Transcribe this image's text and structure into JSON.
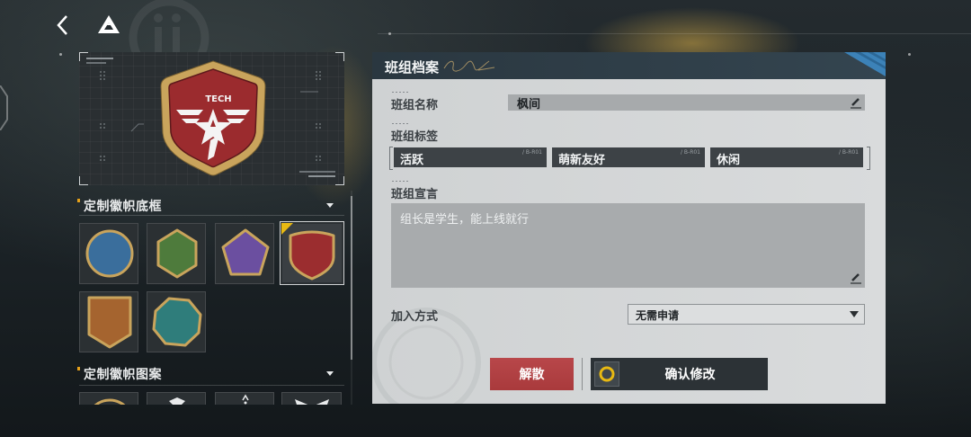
{
  "top_bar": {
    "back_icon": "chevron-left-icon",
    "logo_icon": "triangle-logo-icon"
  },
  "emblem_preview": {
    "emblem_text": "TECH",
    "border_color": "#c9a45c",
    "field_color": "#9b2b2e"
  },
  "frame_section": {
    "title": "定制徽帜底框",
    "toggle_icon": "caret-down-icon",
    "selected_index": 3,
    "options": [
      {
        "icon": "circle-frame-icon",
        "color": "#3a6e9c"
      },
      {
        "icon": "hexagon-frame-icon",
        "color": "#4e7b3c"
      },
      {
        "icon": "pentagon-frame-icon",
        "color": "#6b4fa0"
      },
      {
        "icon": "shield-frame-icon",
        "color": "#9b2d2f"
      },
      {
        "icon": "banner-frame-icon",
        "color": "#a5642f"
      },
      {
        "icon": "octagon-frame-icon",
        "color": "#2f7d7b"
      }
    ]
  },
  "pattern_section": {
    "title": "定制徽帜图案",
    "toggle_icon": "caret-down-icon"
  },
  "profile": {
    "title": "班组档案",
    "name_label": "班组名称",
    "name_value": "枫间",
    "tags_label": "班组标签",
    "tags": [
      {
        "label": "活跃",
        "code": "/ B-R01"
      },
      {
        "label": "萌新友好",
        "code": "/ B-R01"
      },
      {
        "label": "休闲",
        "code": "/ B-R01"
      }
    ],
    "declaration_label": "班组宣言",
    "declaration_value": "组长是学生，能上线就行",
    "join_label": "加入方式",
    "join_value": "无需申请",
    "dissolve_label": "解散",
    "confirm_label": "确认修改",
    "edit_icon": "pencil-icon",
    "confirm_icon": "ring-icon"
  },
  "colors": {
    "accent_yellow": "#e8b912",
    "danger": "#b24143",
    "header_bar": "#2d3a44",
    "stripe_blue": "#3c82b8"
  }
}
